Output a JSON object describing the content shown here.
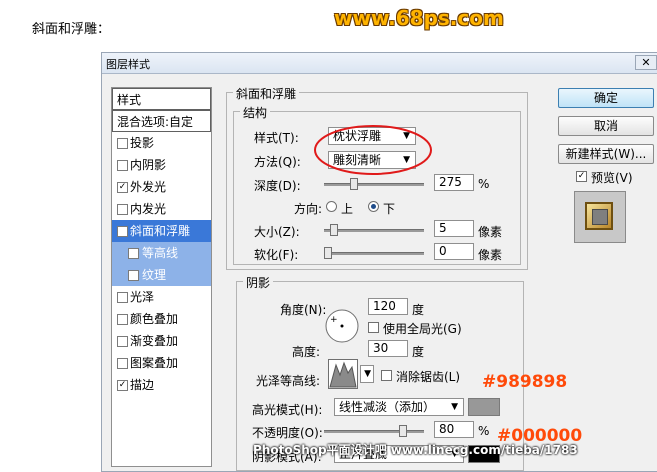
{
  "page": {
    "heading": "斜面和浮雕："
  },
  "watermark_top": "www.68ps.com",
  "dialog": {
    "title": "图层样式",
    "close": "✕",
    "styles_list": [
      {
        "label": "样式",
        "kind": "header"
      },
      {
        "label": "混合选项:自定",
        "kind": "header"
      },
      {
        "label": "投影",
        "checked": false
      },
      {
        "label": "内阴影",
        "checked": false
      },
      {
        "label": "外发光",
        "checked": true
      },
      {
        "label": "内发光",
        "checked": false
      },
      {
        "label": "斜面和浮雕",
        "checked": true,
        "selected": true
      },
      {
        "label": "等高线",
        "checked": true,
        "sub": true
      },
      {
        "label": "纹理",
        "checked": false,
        "sub": true
      },
      {
        "label": "光泽",
        "checked": false
      },
      {
        "label": "颜色叠加",
        "checked": false
      },
      {
        "label": "渐变叠加",
        "checked": false
      },
      {
        "label": "图案叠加",
        "checked": false
      },
      {
        "label": "描边",
        "checked": true
      }
    ],
    "bevel": {
      "group_title": "斜面和浮雕",
      "structure_title": "结构",
      "style_label": "样式(T):",
      "style_value": "枕状浮雕",
      "technique_label": "方法(Q):",
      "technique_value": "雕刻清晰",
      "depth_label": "深度(D):",
      "depth_value": "275",
      "depth_unit": "%",
      "depth_fraction": 0.275,
      "direction_label": "方向:",
      "dir_up": "上",
      "dir_down": "下",
      "direction_value": "下",
      "size_label": "大小(Z):",
      "size_value": "5",
      "size_unit": "像素",
      "soften_label": "软化(F):",
      "soften_value": "0",
      "soften_unit": "像素"
    },
    "shading": {
      "title": "阴影",
      "angle_label": "角度(N):",
      "angle_value": "120",
      "angle_unit": "度",
      "global_light": "使用全局光(G)",
      "global_light_checked": false,
      "altitude_label": "高度:",
      "altitude_value": "30",
      "altitude_unit": "度",
      "gloss_label": "光泽等高线:",
      "antialias": "消除锯齿(L)",
      "antialias_checked": false,
      "highlight_mode_label": "高光模式(H):",
      "highlight_mode_value": "线性减淡（添加）",
      "highlight_color": "#989898",
      "opacity_label": "不透明度(O):",
      "opacity_value": "80",
      "opacity_unit": "%",
      "opacity_fraction": 0.8,
      "shadow_mode_label": "阴影模式(A):",
      "shadow_mode_value": "正片叠底",
      "shadow_color": "#000000"
    },
    "buttons": {
      "ok": "确定",
      "cancel": "取消",
      "new_style": "新建样式(W)...",
      "preview": "预览(V)",
      "preview_checked": true
    }
  },
  "annotations": {
    "highlight_color_text": "#989898",
    "shadow_color_text": "#000000"
  },
  "footer_watermark": "PhotoShop平面设计吧 www.linecg.com/tieba/1783"
}
